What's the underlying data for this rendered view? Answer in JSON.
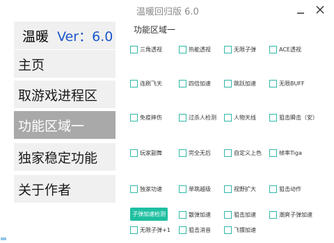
{
  "window": {
    "title": "温暖回归版 6.0",
    "minimize_symbol": "_",
    "close_icon": "close-icon"
  },
  "sidebar": {
    "version": {
      "name": "温暖",
      "ver": "Ver：6.0"
    },
    "items": [
      "主页",
      "取游戏进程区",
      "功能区域一",
      "独家稳定功能",
      "关于作者"
    ],
    "active_index": 2
  },
  "panel": {
    "title": "功能区域一",
    "checkboxes": [
      "三角透视",
      "热能透视",
      "无限子弹",
      "ACE透视",
      "连刷飞天",
      "四倍加速",
      "跳跃加速",
      "无限BUFF",
      "免疫摔伤",
      "过杀人检测",
      "人物天线",
      "狙击瞬击（安）",
      "玩家副舞",
      "完全无后",
      "自定义上色",
      "帧率Tiga",
      "独家功速",
      "单跳越级",
      "视野扩大",
      "狙击动作",
      "散弹加速",
      "狙击加速",
      "潮爽子弹加速",
      "无限子弹+1",
      "狙击消音",
      "飞镖加速"
    ],
    "action_button": "子弹加速检测"
  },
  "colors": {
    "accent": "#1fbfa2",
    "checkbox_border": "#2fb8a8",
    "active_nav": "#a9a9a9",
    "nav_bg": "#f0f0f0",
    "version_blue": "#1a56c8"
  }
}
